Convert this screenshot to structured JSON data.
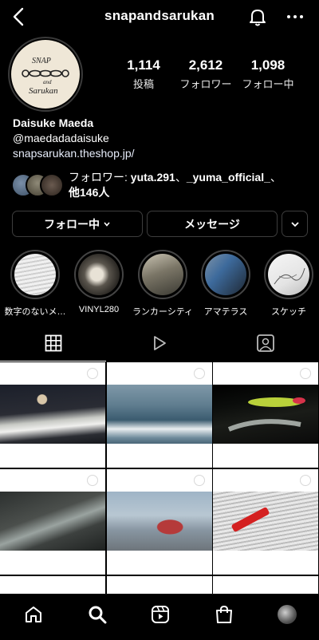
{
  "header": {
    "username": "snapandsarukan"
  },
  "profile": {
    "avatar_text_top": "SNAP",
    "avatar_text_mid": "and",
    "avatar_text_bottom": "Sarukan",
    "posts_count": "1,114",
    "posts_label": "投稿",
    "followers_count": "2,612",
    "followers_label": "フォロワー",
    "following_count": "1,098",
    "following_label": "フォロー中",
    "name": "Daisuke Maeda",
    "handle": "@maedadadaisuke",
    "link": "snapsarukan.theshop.jp/"
  },
  "followed_by": {
    "prefix": "フォロワー: ",
    "user1": "yuta.291",
    "sep": "、",
    "user2": "_yuma_official_",
    "suffix": "、",
    "others": "他146人"
  },
  "actions": {
    "follow_label": "フォロー中",
    "message_label": "メッセージ"
  },
  "highlights": [
    {
      "label": "数字のないメ…"
    },
    {
      "label": "VINYL280"
    },
    {
      "label": "ランカーシティ"
    },
    {
      "label": "アマテラス"
    },
    {
      "label": "スケッチ"
    }
  ],
  "tabs": {
    "active": "posts",
    "items": [
      "posts-grid",
      "reels",
      "tagged"
    ]
  },
  "icons": {
    "back": "back-arrow-icon",
    "bell": "bell-icon",
    "more": "more-dots-icon",
    "grid": "grid-icon",
    "reels": "play-icon",
    "tagged": "tagged-person-icon",
    "home": "home-icon",
    "search": "search-icon",
    "reels_nav": "reels-icon",
    "shop": "shop-bag-icon",
    "profile": "profile-avatar-icon"
  },
  "colors": {
    "background": "#000000",
    "text": "#ffffff",
    "border": "#3d3d3d",
    "accent_red": "#d42020"
  }
}
